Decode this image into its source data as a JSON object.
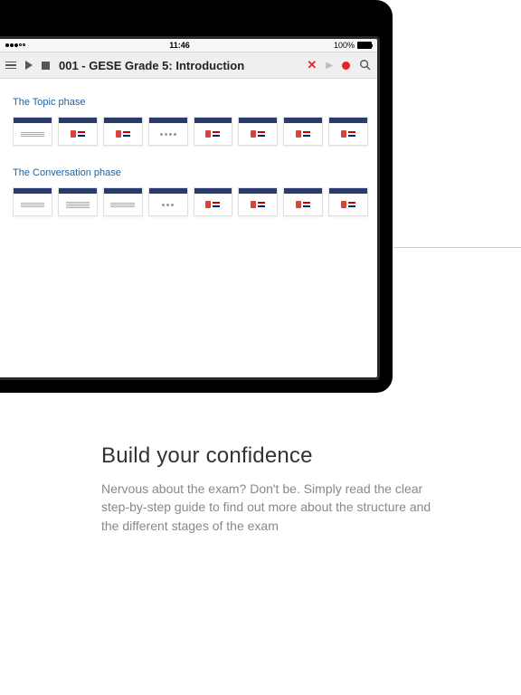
{
  "status": {
    "time": "11:46",
    "battery_label": "100%"
  },
  "toolbar": {
    "title": "001 - GESE Grade 5: Introduction"
  },
  "sections": [
    {
      "title": "The Topic phase"
    },
    {
      "title": "The Conversation phase"
    }
  ],
  "marketing": {
    "heading": "Build your confidence",
    "body": "Nervous about the exam? Don't be. Simply read the clear step-by-step guide to find out more about the structure and the different stages of the exam"
  }
}
